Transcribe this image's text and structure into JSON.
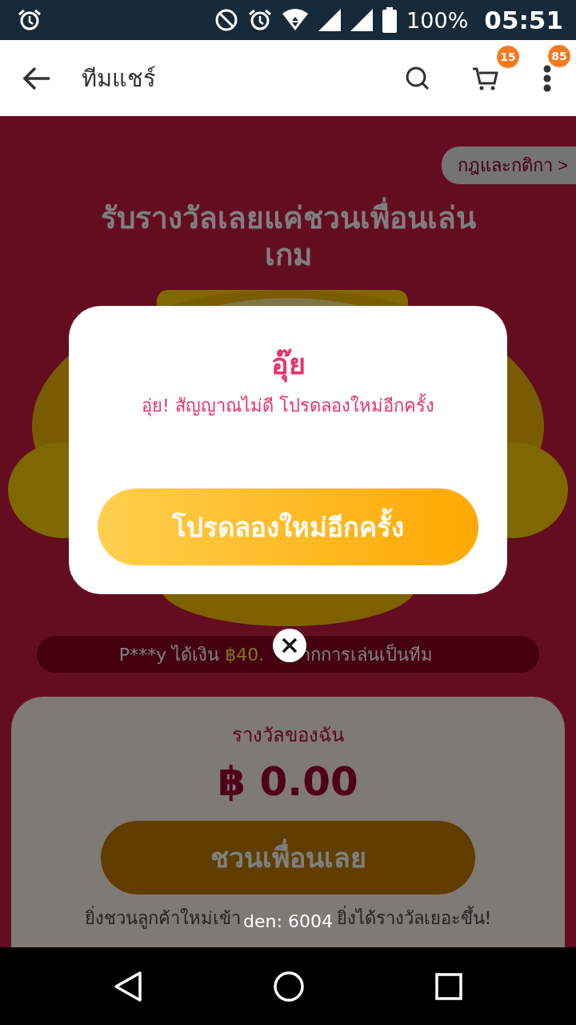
{
  "status_bar": {
    "battery": "100%",
    "time": "05:51"
  },
  "app_bar": {
    "title": "ทีมแชร์",
    "cart_badge": "15",
    "menu_badge": "85"
  },
  "page": {
    "rules_link": "กฎและกติกา >",
    "headline": "รับรางวัลเลยแค่ชวนเพื่อนเล่นเกม",
    "ticker": {
      "winner": "P***y ได้เงิน",
      "amount": "฿40.",
      "rest": "ากการเล่นเป็นทีม"
    },
    "reward_card": {
      "label": "รางวัลของฉัน",
      "amount": "฿ 0.00",
      "button": "ชวนเพื่อนเลย",
      "note_before": "ยิ่งชวนลูกค้าใหม่เข้า",
      "note_after": "ยิ่งได้รางวัลเยอะขึ้น!"
    }
  },
  "dialog": {
    "title": "อุ๊ย",
    "message": "อุ่ย! สัญญาณไม่ดี โปรดลองใหม่อีกครั้ง",
    "button": "โปรดลองใหม่อีกครั้ง"
  },
  "toast": "den: 6004"
}
